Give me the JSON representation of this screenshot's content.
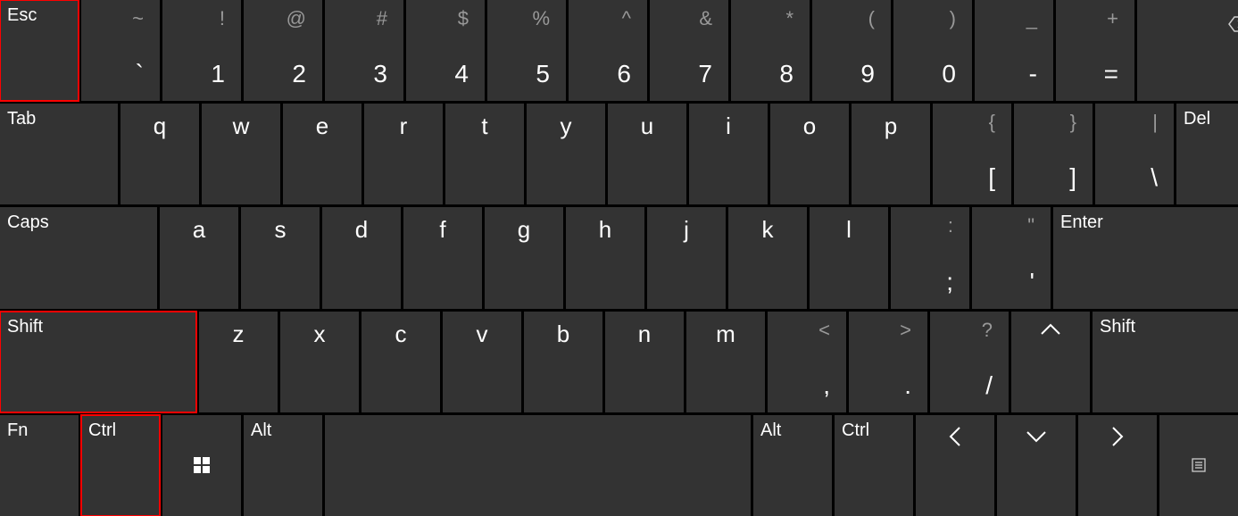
{
  "row1": {
    "esc": "Esc",
    "keys": [
      {
        "shift": "~",
        "main": "`"
      },
      {
        "shift": "!",
        "main": "1"
      },
      {
        "shift": "@",
        "main": "2"
      },
      {
        "shift": "#",
        "main": "3"
      },
      {
        "shift": "$",
        "main": "4"
      },
      {
        "shift": "%",
        "main": "5"
      },
      {
        "shift": "^",
        "main": "6"
      },
      {
        "shift": "&",
        "main": "7"
      },
      {
        "shift": "*",
        "main": "8"
      },
      {
        "shift": "(",
        "main": "9"
      },
      {
        "shift": ")",
        "main": "0"
      },
      {
        "shift": "_",
        "main": "-"
      },
      {
        "shift": "+",
        "main": "="
      }
    ]
  },
  "row2": {
    "tab": "Tab",
    "del": "Del",
    "letters": [
      "q",
      "w",
      "e",
      "r",
      "t",
      "y",
      "u",
      "i",
      "o",
      "p"
    ],
    "punct": [
      {
        "shift": "{",
        "main": "["
      },
      {
        "shift": "}",
        "main": "]"
      },
      {
        "shift": "|",
        "main": "\\"
      }
    ]
  },
  "row3": {
    "caps": "Caps",
    "enter": "Enter",
    "letters": [
      "a",
      "s",
      "d",
      "f",
      "g",
      "h",
      "j",
      "k",
      "l"
    ],
    "punct": [
      {
        "shift": ":",
        "main": ";"
      },
      {
        "shift": "\"",
        "main": "'"
      }
    ]
  },
  "row4": {
    "lshift": "Shift",
    "rshift": "Shift",
    "letters": [
      "z",
      "x",
      "c",
      "v",
      "b",
      "n",
      "m"
    ],
    "punct": [
      {
        "shift": "<",
        "main": ","
      },
      {
        "shift": ">",
        "main": "."
      },
      {
        "shift": "?",
        "main": "/"
      }
    ]
  },
  "row5": {
    "fn": "Fn",
    "ctrl": "Ctrl",
    "alt": "Alt",
    "ralt": "Alt",
    "rctrl": "Ctrl"
  }
}
